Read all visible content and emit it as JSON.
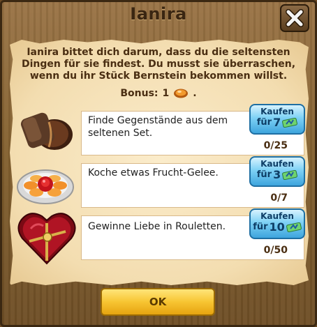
{
  "dialog": {
    "title": "Ianira",
    "intro": "Ianira bittet dich darum, dass du die seltensten Dingen für sie findest. Du musst sie überraschen, wenn du ihr Stück Bernstein bekommen willst.",
    "bonus_label": "Bonus:",
    "bonus_value": "1",
    "bonus_suffix": ".",
    "ok_label": "OK"
  },
  "tasks": [
    {
      "text": "Finde Gegenstände aus dem seltenen Set.",
      "progress": "0/25",
      "buy_label": "Kaufen",
      "buy_prefix": "für",
      "buy_price": "7",
      "icon": "wooden-stamp-icon"
    },
    {
      "text": "Koche etwas Frucht-Gelee.",
      "progress": "0/7",
      "buy_label": "Kaufen",
      "buy_prefix": "für",
      "buy_price": "3",
      "icon": "fruit-plate-icon"
    },
    {
      "text": "Gewinne Liebe in Rouletten.",
      "progress": "0/50",
      "buy_label": "Kaufen",
      "buy_prefix": "für",
      "buy_price": "10",
      "icon": "heart-box-icon"
    }
  ],
  "colors": {
    "accent_buy": "#3ea5dd",
    "ok_button": "#f7c532",
    "text_brown": "#4a2e12"
  }
}
